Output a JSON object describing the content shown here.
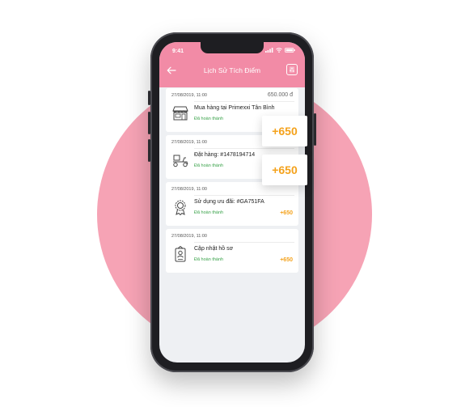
{
  "status_bar": {
    "time": "9:41"
  },
  "header": {
    "title": "Lịch Sử Tích Điểm"
  },
  "transactions": [
    {
      "date": "27/08/2019, 11:00",
      "amount": "650.000 đ",
      "name": "Mua hàng tại Primexxi Tân Bình",
      "status": "Đã hoàn thành",
      "points": "",
      "icon": "store-icon"
    },
    {
      "date": "27/08/2019, 11:00",
      "amount": "",
      "name": "Đặt hàng: #1478194714",
      "status": "Đã hoàn thành",
      "points": "",
      "icon": "delivery-scooter-icon"
    },
    {
      "date": "27/08/2019, 11:00",
      "amount": "",
      "name": "Sử dụng ưu đãi: #GA751FA",
      "status": "Đã hoàn thành",
      "points": "+650",
      "icon": "award-badge-icon"
    },
    {
      "date": "27/08/2019, 11:00",
      "amount": "",
      "name": "Cập nhật hồ sơ",
      "status": "Đã hoàn thành",
      "points": "+650",
      "icon": "profile-card-icon"
    }
  ],
  "highlight_points": [
    "+650",
    "+650"
  ],
  "colors": {
    "header": "#f28ba6",
    "circle": "#f6a3b5",
    "points": "#f4a21c",
    "status": "#3aa24a"
  }
}
